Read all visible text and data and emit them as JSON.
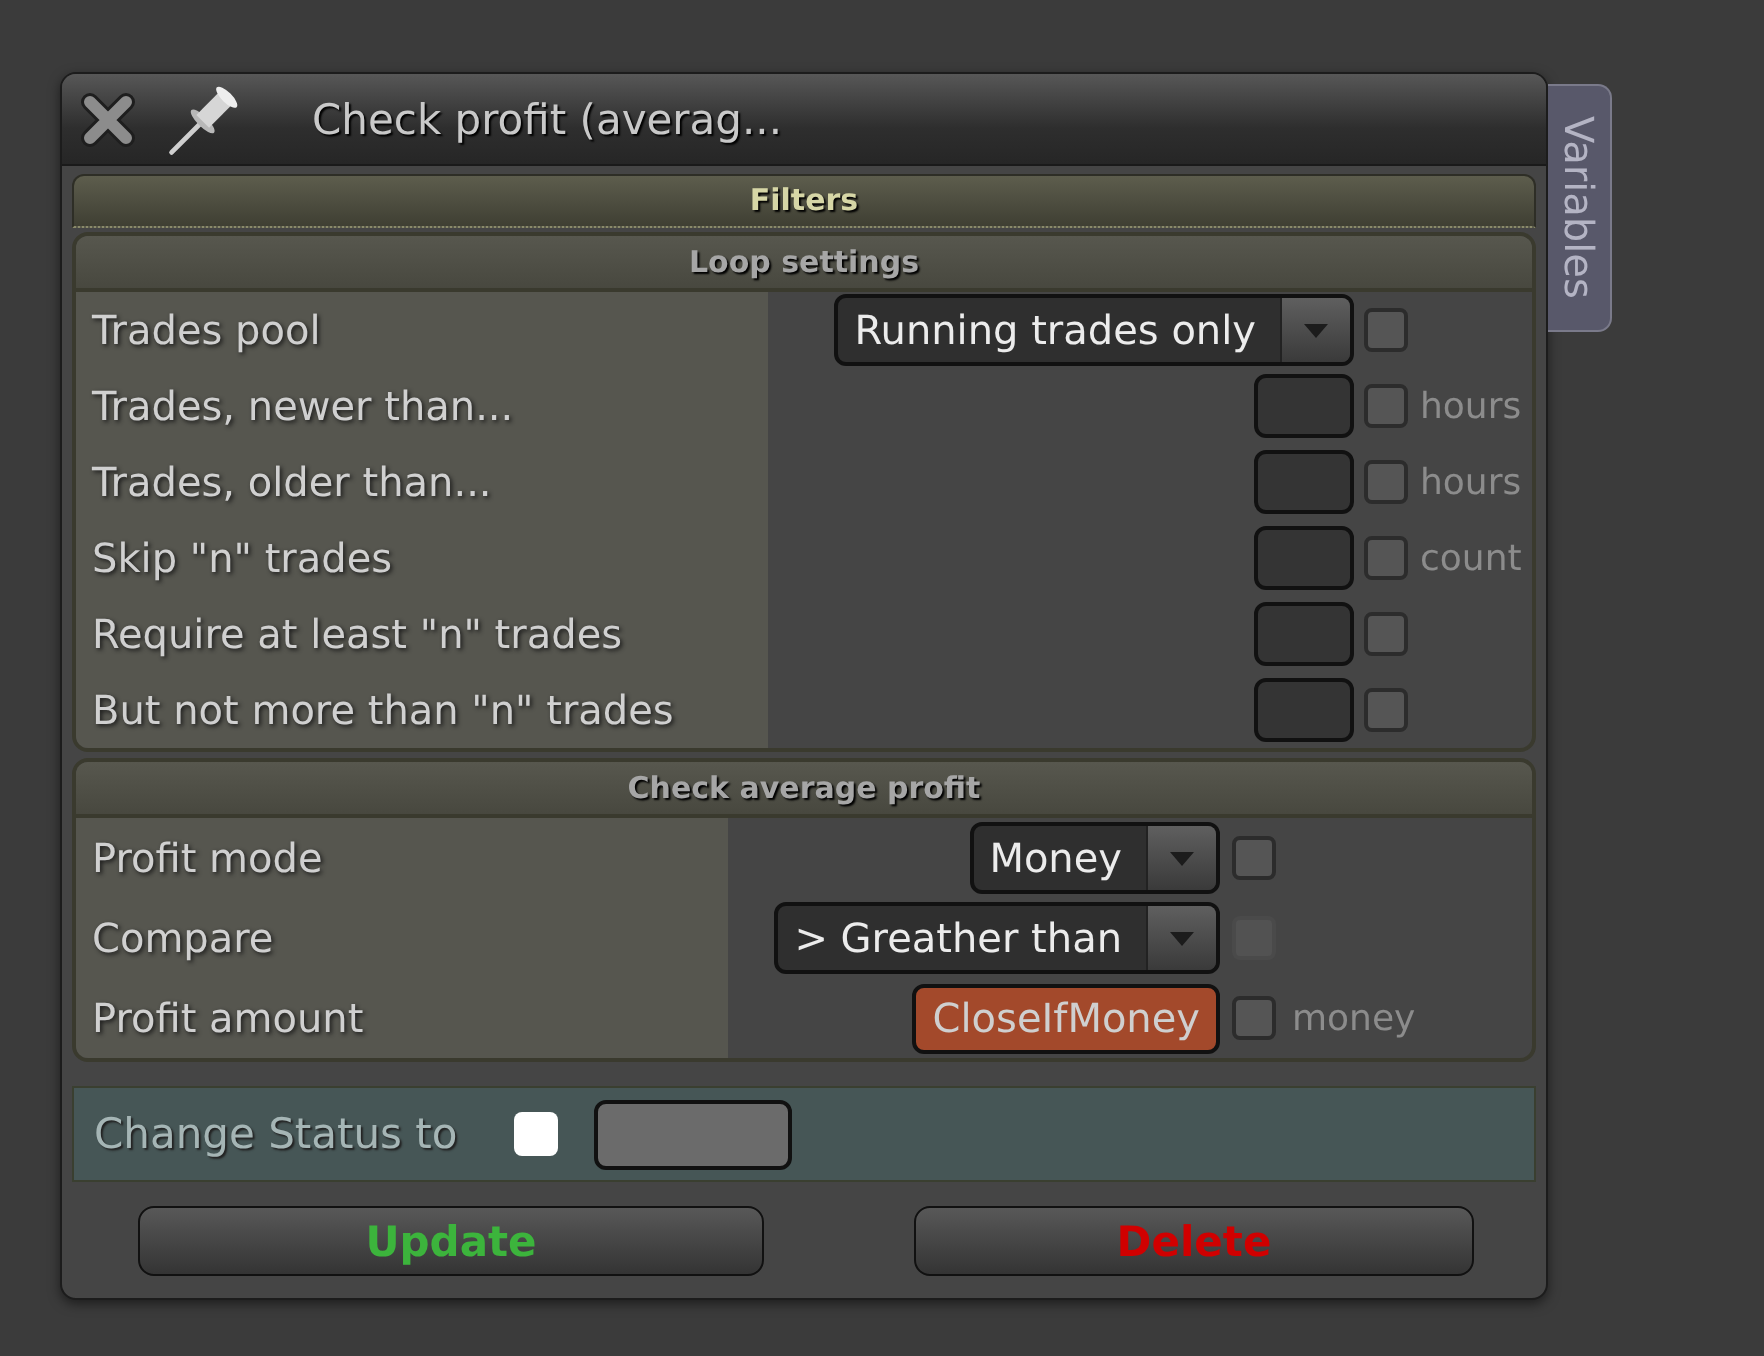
{
  "window": {
    "title": "Check profit (averag...",
    "side_tab": "Variables"
  },
  "filters_header": "Filters",
  "sections": [
    {
      "title": "Loop settings",
      "rows": [
        {
          "kind": "dropdown",
          "label": "Trades pool",
          "value": "Running trades only",
          "checked": false,
          "checkbox_disabled": false
        },
        {
          "kind": "number",
          "label": "Trades, newer than...",
          "checked": false,
          "checkbox_disabled": false,
          "unit": "hours"
        },
        {
          "kind": "number",
          "label": "Trades, older than...",
          "checked": false,
          "checkbox_disabled": false,
          "unit": "hours"
        },
        {
          "kind": "number",
          "label": "Skip \"n\" trades",
          "checked": false,
          "checkbox_disabled": false,
          "unit": "count"
        },
        {
          "kind": "number",
          "label": "Require at least \"n\" trades",
          "checked": false,
          "checkbox_disabled": false
        },
        {
          "kind": "number",
          "label": "But not more than \"n\" trades",
          "checked": false,
          "checkbox_disabled": false
        }
      ]
    },
    {
      "title": "Check average profit",
      "rows": [
        {
          "kind": "dropdown",
          "label": "Profit mode",
          "value": "Money",
          "checked": false,
          "checkbox_disabled": false
        },
        {
          "kind": "dropdown",
          "label": "Compare",
          "value": "> Greather than",
          "checked": false,
          "checkbox_disabled": true
        },
        {
          "kind": "variable",
          "label": "Profit amount",
          "value": "CloseIfMoney",
          "checked": false,
          "checkbox_disabled": false,
          "unit": "money"
        }
      ]
    }
  ],
  "status_row": {
    "label": "Change Status to",
    "checked": false
  },
  "buttons": [
    {
      "label": "Update",
      "color": "#3cb43c"
    },
    {
      "label": "Delete",
      "color": "#d00000"
    }
  ]
}
